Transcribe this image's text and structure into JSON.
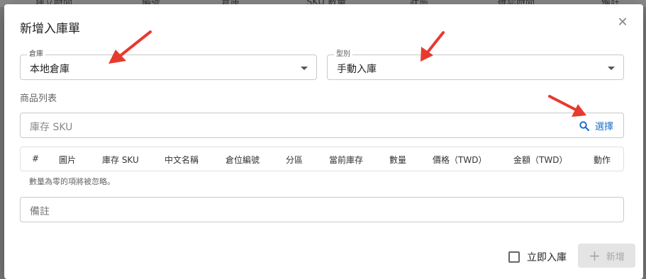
{
  "background": {
    "columns": [
      "建立時間",
      "編號",
      "倉庫",
      "SKU 數量",
      "狀態",
      "確認時間",
      "備註"
    ]
  },
  "dialog": {
    "title": "新增入庫單",
    "warehouse": {
      "label": "倉庫",
      "value": "本地倉庫"
    },
    "type": {
      "label": "型別",
      "value": "手動入庫"
    },
    "products_label": "商品列表",
    "sku_search": {
      "placeholder": "庫存 SKU",
      "select_label": "選擇"
    },
    "table": {
      "headers": [
        "#",
        "圖片",
        "庫存 SKU",
        "中文名稱",
        "倉位編號",
        "分區",
        "當前庫存",
        "數量",
        "價格（TWD）",
        "金額（TWD）",
        "動作"
      ]
    },
    "hint": "數量為零的項將被忽略。",
    "remark_placeholder": "備註",
    "immediate_stock_in_label": "立即入庫",
    "add_button_label": "新增"
  },
  "colors": {
    "accent": "#1a6fc9",
    "annotation_arrow": "#e8392f",
    "disabled_button_bg": "#e4e4e4"
  }
}
